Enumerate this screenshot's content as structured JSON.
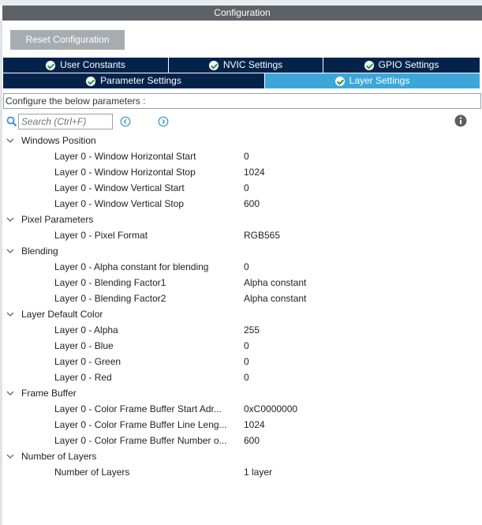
{
  "header": {
    "title": "Configuration"
  },
  "toolbar": {
    "reset_label": "Reset Configuration"
  },
  "tabs": {
    "row1": [
      {
        "label": "User Constants"
      },
      {
        "label": "NVIC Settings"
      },
      {
        "label": "GPIO Settings"
      }
    ],
    "row2": [
      {
        "label": "Parameter Settings"
      },
      {
        "label": "Layer Settings",
        "active": true
      }
    ]
  },
  "description": "Configure the below parameters :",
  "search": {
    "placeholder": "Search (Ctrl+F)"
  },
  "colors": {
    "tab_bg": "#03234b",
    "tab_active_bg": "#3ca6d9",
    "check_green": "#2c9a3c"
  },
  "categories": [
    {
      "name": "Windows Position",
      "params": [
        {
          "name": "Layer 0 - Window Horizontal Start",
          "value": "0"
        },
        {
          "name": "Layer 0 - Window Horizontal Stop",
          "value": "1024"
        },
        {
          "name": "Layer 0 - Window Vertical Start",
          "value": "0"
        },
        {
          "name": "Layer 0 - Window Vertical Stop",
          "value": "600"
        }
      ]
    },
    {
      "name": "Pixel Parameters",
      "params": [
        {
          "name": "Layer 0 - Pixel Format",
          "value": "RGB565"
        }
      ]
    },
    {
      "name": "Blending",
      "params": [
        {
          "name": "Layer 0 - Alpha constant for blending",
          "value": "0"
        },
        {
          "name": "Layer 0 - Blending Factor1",
          "value": "Alpha constant"
        },
        {
          "name": "Layer 0 - Blending Factor2",
          "value": "Alpha constant"
        }
      ]
    },
    {
      "name": "Layer Default Color",
      "params": [
        {
          "name": "Layer 0 - Alpha",
          "value": "255"
        },
        {
          "name": "Layer 0 - Blue",
          "value": "0"
        },
        {
          "name": "Layer 0 - Green",
          "value": "0"
        },
        {
          "name": "Layer 0 - Red",
          "value": "0"
        }
      ]
    },
    {
      "name": "Frame Buffer",
      "params": [
        {
          "name": "Layer 0 - Color Frame Buffer Start Adr...",
          "value": "0xC0000000"
        },
        {
          "name": "Layer 0 - Color Frame Buffer Line Leng...",
          "value": "1024"
        },
        {
          "name": "Layer 0 - Color Frame Buffer Number o...",
          "value": "600"
        }
      ]
    },
    {
      "name": "Number of Layers",
      "params": [
        {
          "name": "Number of Layers",
          "value": "1 layer"
        }
      ]
    }
  ]
}
